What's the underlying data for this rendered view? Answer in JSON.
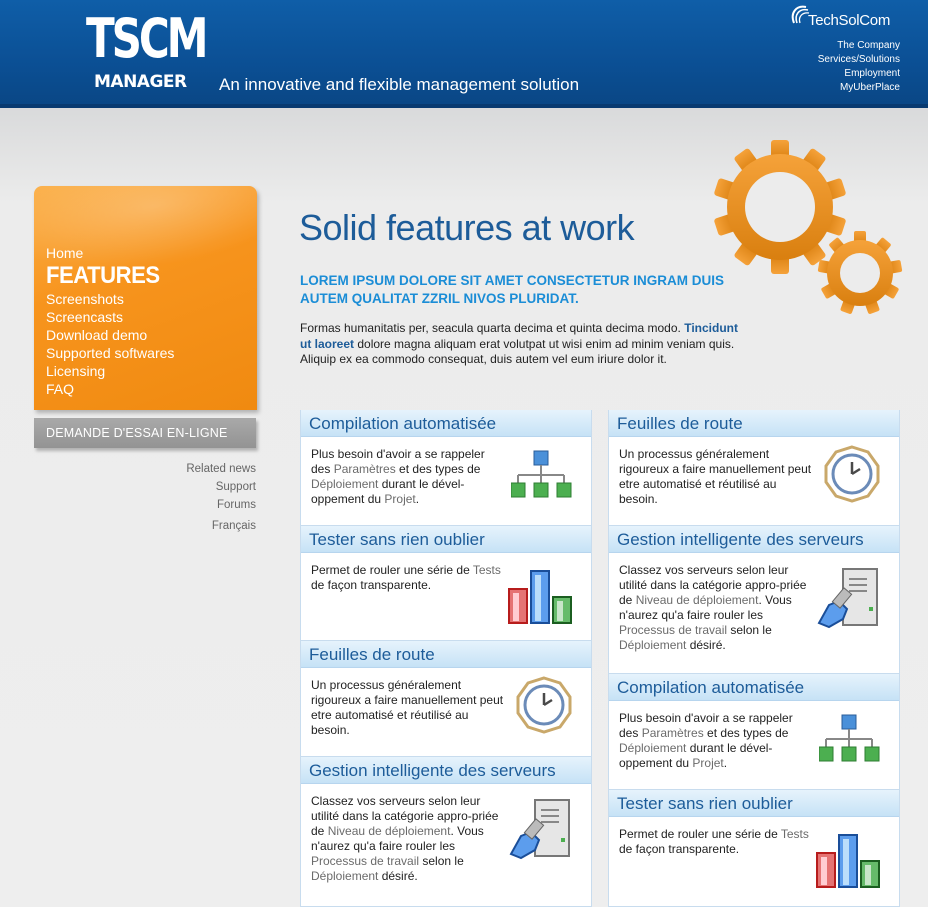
{
  "header": {
    "logo_main": "TSCM",
    "logo_sub": "MANAGER",
    "tagline": "An innovative and flexible management solution",
    "brand": "TechSolCom",
    "links": [
      "The Company",
      "Services/Solutions",
      "Employment",
      "MyUberPlace"
    ]
  },
  "sidebar": {
    "nav": [
      {
        "label": "Home",
        "active": false
      },
      {
        "label": "FEATURES",
        "active": true
      },
      {
        "label": "Screenshots",
        "active": false
      },
      {
        "label": "Screencasts",
        "active": false
      },
      {
        "label": "Download demo",
        "active": false
      },
      {
        "label": "Supported softwares",
        "active": false
      },
      {
        "label": "Licensing",
        "active": false
      },
      {
        "label": "FAQ",
        "active": false
      }
    ],
    "trial_button": "DEMANDE D'ESSAI EN-LIGNE",
    "secondary_links": [
      "Related news",
      "Support",
      "Forums"
    ],
    "language": "Français"
  },
  "main": {
    "title": "Solid features at work",
    "lead": "LOREM IPSUM DOLORE SIT AMET CONSECTETUR INGRAM DUIS AUTEM QUALITAT ZZRIL NIVOS PLURIDAT.",
    "intro_before": "Formas humanitatis per, seacula quarta decima et quinta decima modo. ",
    "intro_strong": "Tincidunt ut laoreet",
    "intro_after": " dolore magna aliquam erat volutpat ut wisi enim ad minim veniam quis. Aliquip ex ea commodo consequat, duis autem vel eum iriure dolor it."
  },
  "cards": {
    "compilation": {
      "title": "Compilation automatisée",
      "t1": "Plus besoin d'avoir a se rappeler des ",
      "h1": "Paramètres",
      "t2": " et des types de ",
      "h2": "Déploiement",
      "t3": " durant le dével-oppement du ",
      "h3": "Projet",
      "t4": "."
    },
    "tester": {
      "title": "Tester sans rien oublier",
      "t1": "Permet de rouler une série de ",
      "h1": "Tests",
      "t2": " de façon transparente."
    },
    "feuilles": {
      "title": "Feuilles de route",
      "t1": "Un processus généralement rigoureux a faire manuellement peut etre automatisé et réutilisé au besoin."
    },
    "gestion": {
      "title": "Gestion intelligente des serveurs",
      "t1": "Classez vos serveurs selon leur utilité dans la catégorie appro-priée de ",
      "h1": "Niveau de déploiement",
      "t2": ". Vous n'aurez qu'a faire rouler les ",
      "h2": "Processus de travail",
      "t3": " selon le ",
      "h3": "Déploiement",
      "t4": " désiré."
    }
  },
  "colors": {
    "header_blue": "#0b4f94",
    "nav_orange": "#f7941d",
    "title_blue": "#1d5c99",
    "lead_blue": "#1b8dd6",
    "gear_orange": "#e8901c"
  },
  "icons": [
    "techsolcom-swoosh-icon",
    "gears-icon",
    "hierarchy-icon",
    "bar-chart-icon",
    "clock-icon",
    "server-icon"
  ]
}
